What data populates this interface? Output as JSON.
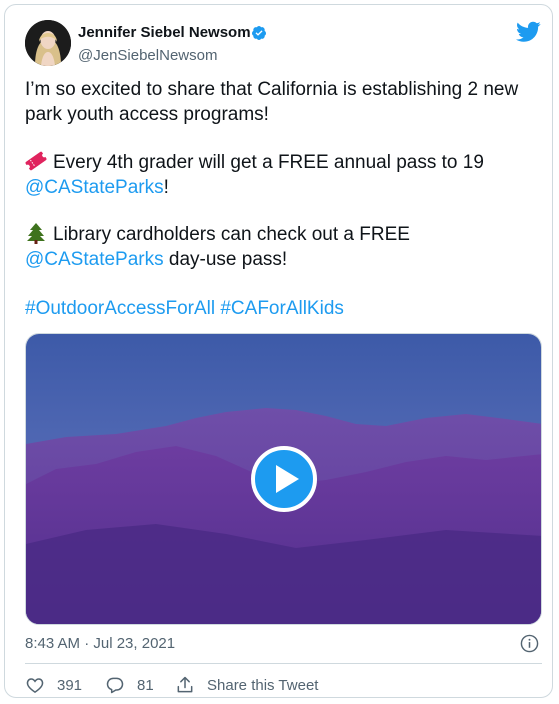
{
  "author": {
    "name": "Jennifer Siebel Newsom",
    "handle": "@JenSiebelNewsom"
  },
  "tweet": {
    "line1": "I’m so excited to share that California is establishing 2 new",
    "line2": "park youth access programs!",
    "item1_text": "Every 4th grader will get a FREE annual pass to 19",
    "item1_link": "@CAStateParks",
    "item1_tail": "!",
    "item2_text": "Library cardholders can check out a FREE",
    "item2_link": "@CAStateParks",
    "item2_tail": " day-use pass!",
    "hashtag1": "#OutdoorAccessForAll",
    "hashtag2": "#CAForAllKids"
  },
  "media": {
    "type": "video",
    "icon": "play-icon"
  },
  "timestamp": "8:43 AM · Jul 23, 2021",
  "actions": {
    "likes": "391",
    "replies": "81",
    "share_label": "Share this Tweet"
  },
  "colors": {
    "link": "#1d9bf0",
    "text": "#0f1419",
    "muted": "#536471",
    "border": "#cfd9de",
    "twitter_blue": "#1d9bf0"
  }
}
